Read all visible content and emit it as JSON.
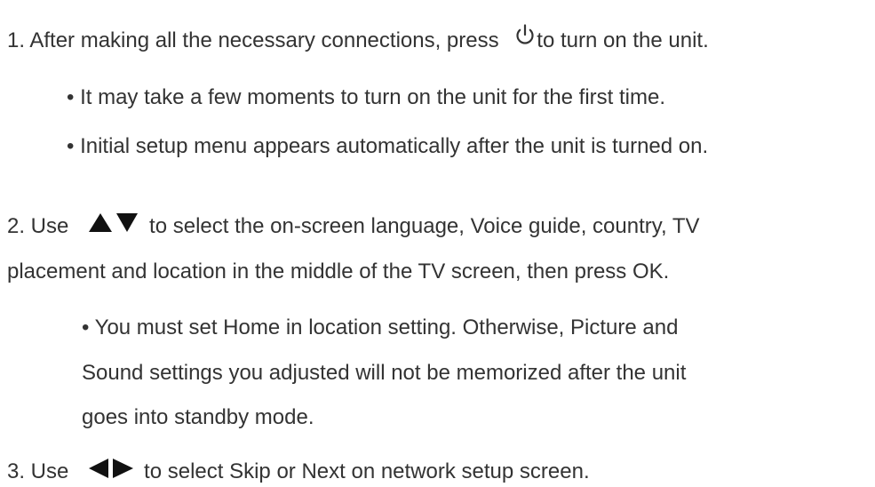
{
  "steps": [
    {
      "before_icon": "1. After making all the necessary connections, press",
      "icon": "power-icon",
      "after_icon": "to turn on the unit.",
      "bullets": [
        "• It may take a few moments to turn on the unit for the first time.",
        "• Initial setup menu appears automatically after the unit is turned on."
      ]
    },
    {
      "before_icon": "2. Use",
      "icon": "up-down-arrows-icon",
      "after_icon": "to select the on-screen language, Voice guide, country, TV",
      "continuation": "placement and location in the middle of the TV screen, then press OK.",
      "bullet_lines": [
        "• You must set Home in location setting. Otherwise, Picture and",
        "Sound settings you adjusted will not be memorized after the unit",
        "goes into standby mode."
      ]
    },
    {
      "before_icon": "3. Use",
      "icon": "left-right-arrows-icon",
      "after_icon": "to select Skip or Next on network setup screen."
    }
  ]
}
